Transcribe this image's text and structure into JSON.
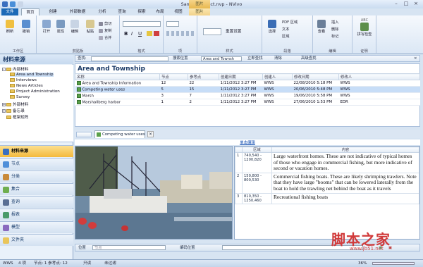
{
  "window": {
    "title": "Sample Project.nvp - NVivo",
    "ctx_header": "图片"
  },
  "tabs": [
    "文件",
    "首页",
    "创建",
    "外部数据",
    "分析",
    "查询",
    "探索",
    "布局",
    "视图",
    "图片"
  ],
  "ribbon": {
    "workspace": {
      "label": "工作区",
      "buttons": [
        "刷新",
        "撤销"
      ]
    },
    "clipboard": {
      "label": "剪贴板",
      "buttons": [
        "打开",
        "属性",
        "编辑",
        "粘贴"
      ],
      "items": [
        "剪切",
        "复制",
        "合并"
      ]
    },
    "item": {
      "label": "项",
      "items": [
        "选择"
      ]
    },
    "format": {
      "label": "格式",
      "items": [
        "B",
        "I",
        "U"
      ]
    },
    "paragraph": {
      "label": "段落",
      "items": [
        "重置设置"
      ]
    },
    "style": {
      "label": "样式",
      "buttons": [
        "选择",
        "查找"
      ],
      "items": [
        "PDF 区域",
        "文本",
        "区域"
      ]
    },
    "editing": {
      "label": "编辑",
      "buttons": [
        "查看",
        "合并"
      ],
      "items": [
        "插入",
        "删除",
        "标记"
      ]
    },
    "proofing": {
      "label": "证明",
      "buttons": [
        "拼写检查"
      ],
      "items": [
        "ABC"
      ]
    }
  },
  "left_pane": {
    "title": "材料来源",
    "tree": [
      {
        "label": "内部材料",
        "level": 0,
        "expand": "-"
      },
      {
        "label": "Area and Township",
        "level": 1,
        "selected": true
      },
      {
        "label": "Interviews",
        "level": 1
      },
      {
        "label": "News Articles",
        "level": 1
      },
      {
        "label": "Project Administration",
        "level": 1
      },
      {
        "label": "Survey",
        "level": 1
      },
      {
        "label": "外部材料",
        "level": 0,
        "expand": "+"
      },
      {
        "label": "备忘录",
        "level": 0,
        "expand": "+"
      },
      {
        "label": "框架矩阵",
        "level": 0,
        "expand": ""
      }
    ],
    "nav": [
      {
        "label": "材料来源",
        "selected": true
      },
      {
        "label": "节点"
      },
      {
        "label": "分类"
      },
      {
        "label": "集合"
      },
      {
        "label": "查询"
      },
      {
        "label": "报表"
      },
      {
        "label": "模型"
      },
      {
        "label": "文件夹"
      }
    ]
  },
  "findbar": {
    "find_label": "查找:",
    "search_in": "搜索位置",
    "search_value": "Area and Townsh",
    "find_now": "立即查找",
    "clear": "清除",
    "advanced": "高级查找"
  },
  "list": {
    "title": "Area and Township",
    "columns": [
      "名称",
      "节点",
      "参考点",
      "创建日期",
      "创建人",
      "修改日期",
      "修改人"
    ],
    "rows": [
      [
        "Area and Township Information",
        "12",
        "22",
        "1/11/2012 3:27 PM",
        "WWS",
        "22/08/2010 5:18 PM",
        "WWS"
      ],
      [
        "Competing water uses",
        "5",
        "15",
        "1/11/2012 3:27 PM",
        "WWS",
        "20/06/2010 5:48 PM",
        "WWS"
      ],
      [
        "Marsh",
        "3",
        "7",
        "1/11/2012 3:27 PM",
        "WWS",
        "19/06/2010 5:58 PM",
        "WWS"
      ],
      [
        "Marshallberg harbor",
        "1",
        "2",
        "1/11/2012 3:27 PM",
        "WWS",
        "27/06/2010 1:53 PM",
        "EDR"
      ]
    ]
  },
  "doc": {
    "tab_label": "Competing water uses",
    "close": "×",
    "link": "单击编辑",
    "region_headers": [
      "",
      "区域",
      "内容"
    ],
    "regions": [
      {
        "num": "1",
        "range": "740,540 - 1200,820",
        "content": "Large waterfront homes. These are not indicative of typical homes of those who engage in commercial fishing, but more indicative of second or vacation homes."
      },
      {
        "num": "2",
        "range": "150,800 - 800,530",
        "content": "Commercial fishing boats. These are likely shrimping trawlers. Note that they have large \"booms\" that can be lowered laterally from the boat to hold the trawling net behind the boat as it travels"
      },
      {
        "num": "3",
        "range": "810,350 - 1250,460",
        "content": "Recreational fishing boats"
      }
    ]
  },
  "bottombar": {
    "position_label": "位置",
    "position_value": "节点",
    "temp_label": "编码位置"
  },
  "status": {
    "user": "WWS",
    "items": "4 项",
    "selection": "节点: 1 参考点: 12",
    "read_only": "只读",
    "no_filter": "未过滤",
    "zoom": "36%"
  },
  "watermark": {
    "main": "脚本之家",
    "url": "www.jb51.net"
  },
  "colors": {
    "accent": "#1d6ab7",
    "selected_nav": "#f4b93c",
    "link": "#0645ad"
  }
}
